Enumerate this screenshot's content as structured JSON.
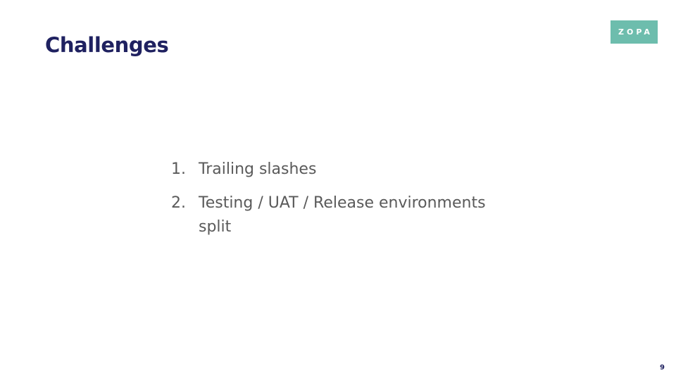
{
  "slide": {
    "title": "Challenges",
    "logo_text": "ZOPA",
    "page_number": "9",
    "items": [
      {
        "number": "1.",
        "text": "Trailing slashes"
      },
      {
        "number": "2.",
        "text": "Testing / UAT / Release environments split"
      }
    ]
  },
  "colors": {
    "title": "#1f2160",
    "body_text": "#5a5a5a",
    "logo_background": "#6dbdad",
    "background": "#ffffff"
  }
}
